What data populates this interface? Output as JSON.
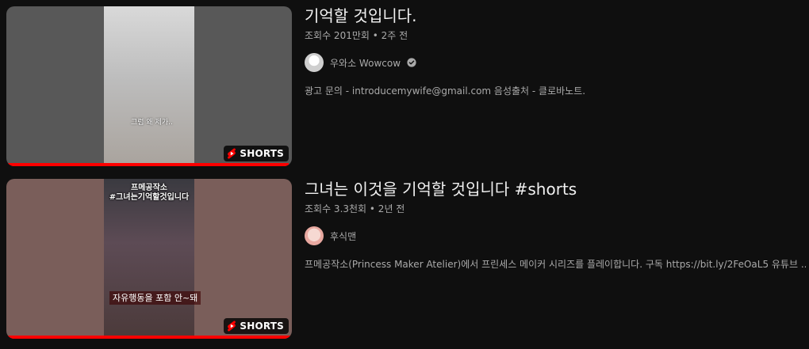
{
  "videos": [
    {
      "title": "기억할 것입니다.",
      "meta": "조회수 201만회 • 2주 전",
      "channel": "우와소 Wowcow",
      "verified": true,
      "description": "광고 문의 - introducemywife@gmail.com 음성출처 - 클로바노트.",
      "badge": "SHORTS",
      "caption": "그럼 왜 제가..",
      "progress": 0.99
    },
    {
      "title": "그녀는 이것을 기억할 것입니다 #shorts",
      "meta": "조회수 3.3천회 • 2년 전",
      "channel": "후식맨",
      "verified": false,
      "description": "프메공작소(Princess Maker Atelier)에서 프린세스 메이커 시리즈를 플레이합니다. 구독 https://bit.ly/2FeOaL5 유튜브 ...",
      "badge": "SHORTS",
      "thumb_title_1": "프메공작소",
      "thumb_title_2": "#그녀는기억할것입니다",
      "thumb_sub": "자유행동을 포함 안~돼",
      "progress": 1.0
    }
  ],
  "colors": {
    "background": "#0f0f0f",
    "progress": "#ff0000",
    "secondary_text": "#aaaaaa"
  },
  "icons": {
    "shorts": "shorts-logo-icon",
    "verified": "verified-check-icon"
  }
}
